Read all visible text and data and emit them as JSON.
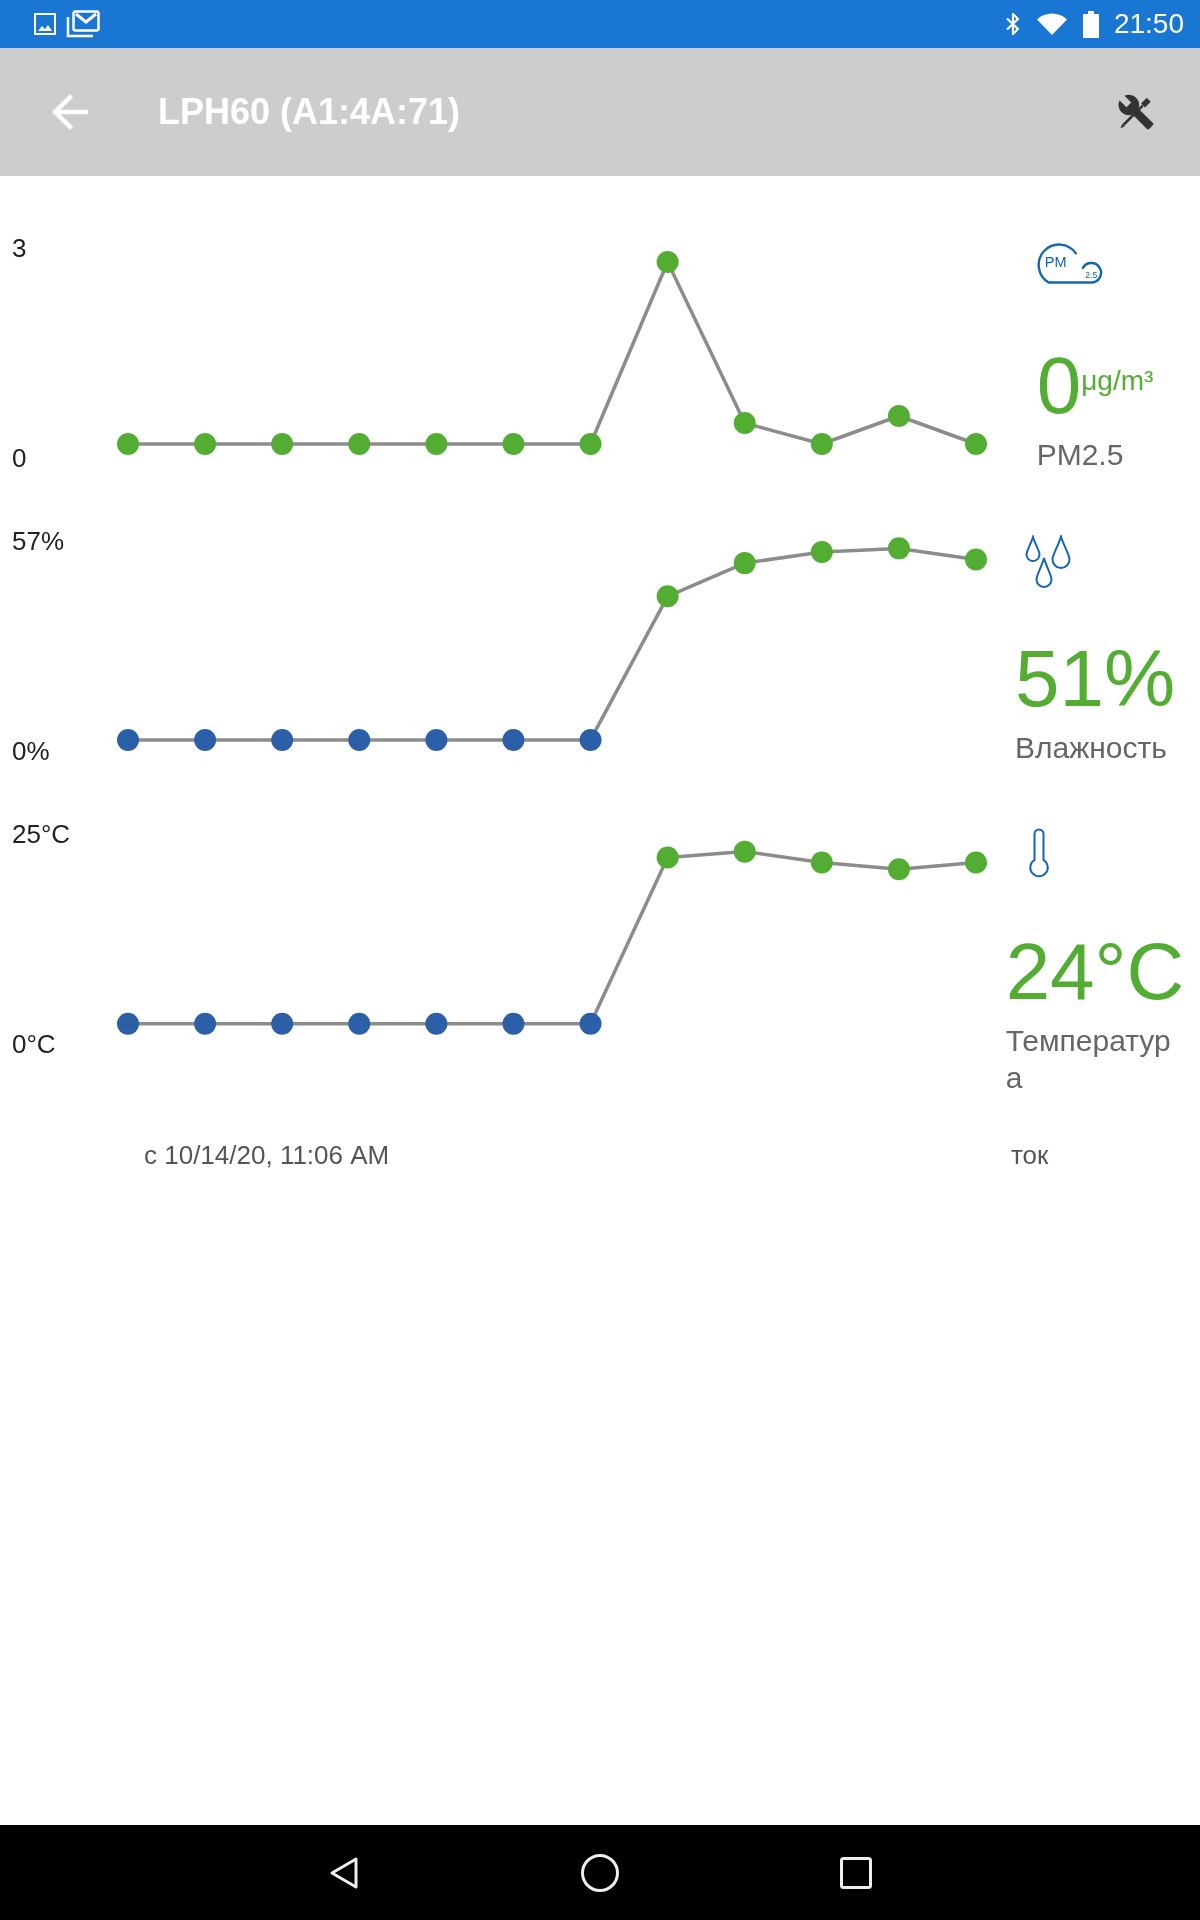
{
  "status_bar": {
    "time": "21:50"
  },
  "app_bar": {
    "title": "LPH60 (A1:4A:71)"
  },
  "sensors": [
    {
      "kind": "pm25",
      "icon_text": "PM",
      "icon_subtext": "2.5",
      "reading": "0",
      "unit": "μg/m³",
      "label": "PM2.5",
      "chart_data": {
        "type": "line",
        "categories": [
          null,
          null,
          null,
          null,
          null,
          null,
          null,
          null,
          null,
          null,
          null,
          null
        ],
        "ylim": [
          0,
          3
        ],
        "yticks": [
          {
            "value": 0,
            "label": "0"
          },
          {
            "value": 3,
            "label": "3"
          }
        ],
        "series": [
          {
            "color": "#8c8c8c",
            "marker": "circle",
            "values": [
              0.2,
              0.2,
              0.2,
              0.2,
              0.2,
              0.2,
              0.2,
              2.8,
              0.5,
              0.2,
              0.6,
              0.2
            ]
          }
        ]
      },
      "point_markers": [
        {
          "color": "#52ad32"
        },
        {
          "color": "#52ad32"
        },
        {
          "color": "#52ad32"
        },
        {
          "color": "#52ad32"
        },
        {
          "color": "#52ad32"
        },
        {
          "color": "#52ad32"
        },
        {
          "color": "#52ad32"
        },
        {
          "color": "#52ad32"
        },
        {
          "color": "#52ad32"
        },
        {
          "color": "#52ad32"
        },
        {
          "color": "#52ad32"
        },
        {
          "color": "#52ad32"
        }
      ]
    },
    {
      "kind": "humidity",
      "reading": "51%",
      "label": "Влажность",
      "chart_data": {
        "type": "line",
        "categories": [
          null,
          null,
          null,
          null,
          null,
          null,
          null,
          null,
          null,
          null,
          null,
          null
        ],
        "ylim": [
          0,
          57
        ],
        "yticks": [
          {
            "value": 0,
            "label": "0%"
          },
          {
            "value": 57,
            "label": "57%"
          }
        ],
        "series": [
          {
            "color": "#8c8c8c",
            "marker": "circle",
            "values": [
              3,
              3,
              3,
              3,
              3,
              3,
              3,
              42,
              51,
              54,
              55,
              52
            ]
          }
        ]
      },
      "point_markers": [
        {
          "color": "#2b60a8"
        },
        {
          "color": "#2b60a8"
        },
        {
          "color": "#2b60a8"
        },
        {
          "color": "#2b60a8"
        },
        {
          "color": "#2b60a8"
        },
        {
          "color": "#2b60a8"
        },
        {
          "color": "#2b60a8"
        },
        {
          "color": "#52ad32"
        },
        {
          "color": "#52ad32"
        },
        {
          "color": "#52ad32"
        },
        {
          "color": "#52ad32"
        },
        {
          "color": "#52ad32"
        }
      ]
    },
    {
      "kind": "temperature",
      "reading": "24°C",
      "label": "Температура",
      "chart_data": {
        "type": "line",
        "categories": [
          null,
          null,
          null,
          null,
          null,
          null,
          null,
          null,
          null,
          null,
          null,
          null
        ],
        "ylim": [
          0,
          25
        ],
        "yticks": [
          {
            "value": 0,
            "label": "0°C"
          },
          {
            "value": 25,
            "label": "25°C"
          }
        ],
        "series": [
          {
            "color": "#8c8c8c",
            "marker": "circle",
            "values": [
              2.4,
              2.4,
              2.4,
              2.4,
              2.4,
              2.4,
              2.4,
              22.2,
              22.9,
              21.6,
              20.8,
              21.6
            ]
          }
        ]
      },
      "point_markers": [
        {
          "color": "#2b60a8"
        },
        {
          "color": "#2b60a8"
        },
        {
          "color": "#2b60a8"
        },
        {
          "color": "#2b60a8"
        },
        {
          "color": "#2b60a8"
        },
        {
          "color": "#2b60a8"
        },
        {
          "color": "#2b60a8"
        },
        {
          "color": "#52ad32"
        },
        {
          "color": "#52ad32"
        },
        {
          "color": "#52ad32"
        },
        {
          "color": "#52ad32"
        },
        {
          "color": "#52ad32"
        }
      ]
    }
  ],
  "footer": {
    "since": "с 10/14/20, 11:06 AM",
    "trailing": "ток"
  }
}
